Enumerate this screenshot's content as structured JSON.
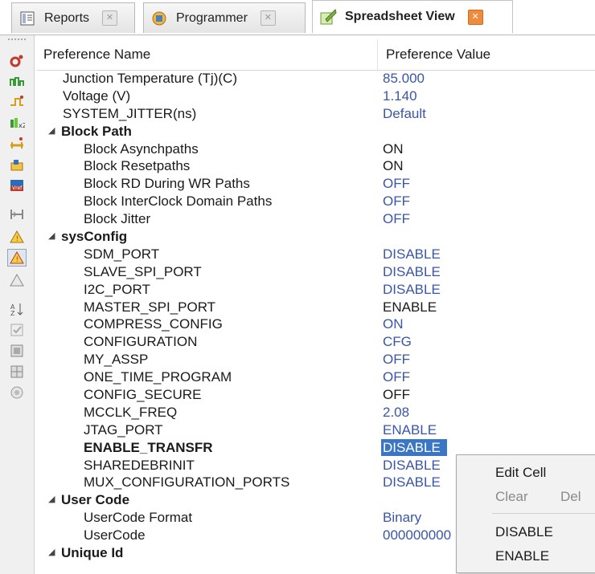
{
  "tabs": [
    {
      "label": "Reports",
      "icon": "report-icon",
      "active": false
    },
    {
      "label": "Programmer",
      "icon": "programmer-icon",
      "active": false
    },
    {
      "label": "Spreadsheet View",
      "icon": "spreadsheet-icon",
      "active": true
    }
  ],
  "toolbar_icons": [
    "port-assignments-icon",
    "timing-preferences-icon",
    "clock-preferences-icon",
    "route-priority-icon",
    "cell-mapping-icon",
    "group-icon",
    "global-preferences-icon",
    "timing-analysis-icon",
    "warning-icon",
    "warning-selected-icon",
    "warning-outline-icon",
    "sort-icon",
    "check-icon",
    "pin-layout-icon",
    "package-view-icon",
    "circle-icon"
  ],
  "table": {
    "col_name": "Preference Name",
    "col_value": "Preference Value",
    "rows": [
      {
        "name": "Junction Temperature (Tj)(C)",
        "value": "85.000",
        "level": 1,
        "vcolor": "blue"
      },
      {
        "name": "Voltage (V)",
        "value": "1.140",
        "level": 1,
        "vcolor": "blue"
      },
      {
        "name": "SYSTEM_JITTER(ns)",
        "value": "Default",
        "level": 1,
        "vcolor": "blue"
      },
      {
        "name": "Block Path",
        "value": "",
        "level": 0,
        "group": true
      },
      {
        "name": "Block Asynchpaths",
        "value": "ON",
        "level": 2,
        "vcolor": "black"
      },
      {
        "name": "Block Resetpaths",
        "value": "ON",
        "level": 2,
        "vcolor": "black"
      },
      {
        "name": "Block RD During WR Paths",
        "value": "OFF",
        "level": 2,
        "vcolor": "blue"
      },
      {
        "name": "Block InterClock Domain Paths",
        "value": "OFF",
        "level": 2,
        "vcolor": "blue"
      },
      {
        "name": "Block Jitter",
        "value": "OFF",
        "level": 2,
        "vcolor": "blue"
      },
      {
        "name": "sysConfig",
        "value": "",
        "level": 0,
        "group": true
      },
      {
        "name": "SDM_PORT",
        "value": "DISABLE",
        "level": 2,
        "vcolor": "blue"
      },
      {
        "name": "SLAVE_SPI_PORT",
        "value": "DISABLE",
        "level": 2,
        "vcolor": "blue"
      },
      {
        "name": "I2C_PORT",
        "value": "DISABLE",
        "level": 2,
        "vcolor": "blue"
      },
      {
        "name": "MASTER_SPI_PORT",
        "value": "ENABLE",
        "level": 2,
        "vcolor": "black"
      },
      {
        "name": "COMPRESS_CONFIG",
        "value": "ON",
        "level": 2,
        "vcolor": "blue"
      },
      {
        "name": "CONFIGURATION",
        "value": "CFG",
        "level": 2,
        "vcolor": "blue"
      },
      {
        "name": "MY_ASSP",
        "value": "OFF",
        "level": 2,
        "vcolor": "blue"
      },
      {
        "name": "ONE_TIME_PROGRAM",
        "value": "OFF",
        "level": 2,
        "vcolor": "blue"
      },
      {
        "name": "CONFIG_SECURE",
        "value": "OFF",
        "level": 2,
        "vcolor": "black"
      },
      {
        "name": "MCCLK_FREQ",
        "value": "2.08",
        "level": 2,
        "vcolor": "blue"
      },
      {
        "name": "JTAG_PORT",
        "value": "ENABLE",
        "level": 2,
        "vcolor": "blue"
      },
      {
        "name": "ENABLE_TRANSFR",
        "value": "DISABLE",
        "level": 2,
        "vcolor": "blue",
        "bold": true,
        "selected": true
      },
      {
        "name": "SHAREDEBRINIT",
        "value": "DISABLE",
        "level": 2,
        "vcolor": "blue"
      },
      {
        "name": "MUX_CONFIGURATION_PORTS",
        "value": "DISABLE",
        "level": 2,
        "vcolor": "blue"
      },
      {
        "name": "User Code",
        "value": "",
        "level": 0,
        "group": true
      },
      {
        "name": "UserCode Format",
        "value": "Binary",
        "level": 2,
        "vcolor": "blue"
      },
      {
        "name": "UserCode",
        "value": "000000000",
        "level": 2,
        "vcolor": "blue"
      },
      {
        "name": "Unique Id",
        "value": "",
        "level": 0,
        "group": true
      }
    ]
  },
  "context_menu": {
    "edit_cell": "Edit Cell",
    "clear": "Clear",
    "clear_shortcut": "Del",
    "opt_disable": "DISABLE",
    "opt_enable": "ENABLE"
  },
  "colors": {
    "value_blue": "#3a56a8",
    "selection": "#3a76c4",
    "close_active": "#f08a3c"
  }
}
